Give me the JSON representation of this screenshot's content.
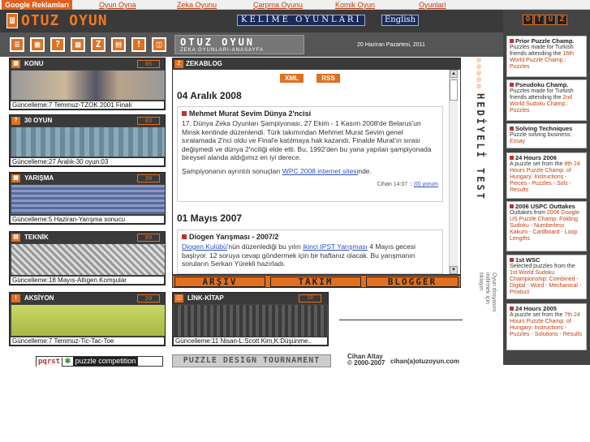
{
  "adbar": {
    "label": "Google Reklamları",
    "links": [
      "Oyun Oyna",
      "Zeka Oyunu",
      "Çarpma Oyunu",
      "Komik Oyun",
      "Oyunlari"
    ]
  },
  "header": {
    "logo_text": "OTUZ OYUN",
    "kelime": "KELİME OYUNLARI",
    "english": "English"
  },
  "bar2": {
    "brand_title": "OTUZ OYUN",
    "brand_sub": "ZEKA OYUNLARI-ANASAYFA",
    "date": "20 Haziran Pazartesi, 2011"
  },
  "panels": [
    {
      "title": "KONU",
      "num": "05",
      "update": "Güncelleme:7 Temmuz-TZOK 2001 Finali"
    },
    {
      "title": "30 OYUN",
      "num": "03",
      "update": "Güncelleme:27 Aralık-30 oyun:03"
    },
    {
      "title": "YARIŞMA",
      "num": "30",
      "update": "Güncelleme:5 Haziran-Yarışma sonucu"
    },
    {
      "title": "TEKNİK",
      "num": "09",
      "update": "Güncelleme:18 Mayıs-Altıgen Komşular"
    },
    {
      "title": "AKSİYON",
      "num": "20",
      "update": "Güncelleme:7 Temmuz-Tic-Tac-Toe"
    }
  ],
  "zekablog": {
    "title": "ZEKABLOG",
    "xml": "XML",
    "rss": "RSS",
    "entries": [
      {
        "date": "04 Aralık 2008",
        "post_title": "Mehmet Murat Sevim Dünya 2'ncisi",
        "body": "17. Dünya Zeka Oyunları Şampiyonası, 27 Ekim - 1 Kasım 2008'de Belarus'un Minsk kentinde düzenlendi. Türk takımından Mehmet Murat Sevim genel sıralamada 2'nci oldu ve Final'e katılmaya hak kazandı. Finalde Murat'ın sırası değişmedi ve dünya 2'nciliği elde etti. Bu, 1992'den bu yana yapılan şampiyonada bireysel alanda aldığımız en iyi derece.",
        "body2_pre": "Şampiyonanın ayrıntılı sonuçları ",
        "body2_link": "WPC 2008 internet sitesi",
        "body2_post": "nde.",
        "meta_author": "Cihan 14:07",
        "meta_comments": "(0) yorum"
      },
      {
        "date": "01 Mayıs 2007",
        "post_title": "Diogen Yarışması - 2007/2",
        "link1": "Diogen Kulübü",
        "text1": "'nün düzenlediği bu yılın ",
        "link2": "ikinci IPST Yarışması",
        "text2": " 4 Mayıs gecesi başlıyor. 12 soruya cevap göndermek için bir haftanız olacak. Bu yarışmanın soruların Serkan Yürekli hazırladı."
      }
    ]
  },
  "nav_buttons": [
    "ARŞİV",
    "TAKIM",
    "BLOGGER"
  ],
  "link_panel": {
    "title": "LİNK-KİTAP",
    "num": "18",
    "update": "Güncelleme:11 Nisan-L:Scott Kim,K:Düşünme.."
  },
  "hediye": {
    "title": "HEDİYELİ TEST",
    "sub": "Oyun dosyasını indirmek için tıklayın"
  },
  "right_logo": [
    "O",
    "T",
    "U",
    "Z"
  ],
  "right_boxes": [
    {
      "title": "Prior Puzzle Champ.",
      "text": "Puzzles made for Turkish friends attending the ",
      "link": "16th World Puzzle Champ.: Puzzles"
    },
    {
      "title": "Pseudoku Champ.",
      "text": "Puzzles made for Turkish friends attending the ",
      "link": "2nd World Sudoku Champ.: Puzzles"
    },
    {
      "title": "Solving Techniques",
      "text": "Puzzle solving business: ",
      "link": "Essay"
    },
    {
      "title": "24 Hours 2006",
      "text": "A puzzle set from the ",
      "link": "8th 24 Hours Puzzle Champ. of Hungary: Instructions - Pieces - Puzzles - Sols - Results"
    },
    {
      "title": "2006 USPC Outtakes",
      "text": "Outtakes from ",
      "link": "2006 Google US Puzzle Champ: Folding Sudoku - Numberless Kakuro - Cardboard - Loop Lengths"
    },
    {
      "title": "1st WSC",
      "text": "Selected puzzles from the ",
      "link": "1st World Sudoku Championship: Combined - Digital - Word - Mechanical - Product"
    },
    {
      "title": "24 Hours 2005",
      "text": "A puzzle set from the ",
      "link": "7th 24 Hours Puzzle Champ. of Hungary: Instructions - Puzzles - Solutions - Results"
    }
  ],
  "footer": {
    "pqrst": "pqrst",
    "puzzle_comp": "puzzle competition",
    "pdt": "PUZZLE DESIGN TOURNAMENT",
    "copyright_name": "Cihan Altay",
    "copyright_years": "© 2000-2007",
    "email": "cihan(a)otuzoyun.com"
  },
  "colors": {
    "accent": "#e07020",
    "dark": "#3a3a3a",
    "link": "#3050c0"
  }
}
